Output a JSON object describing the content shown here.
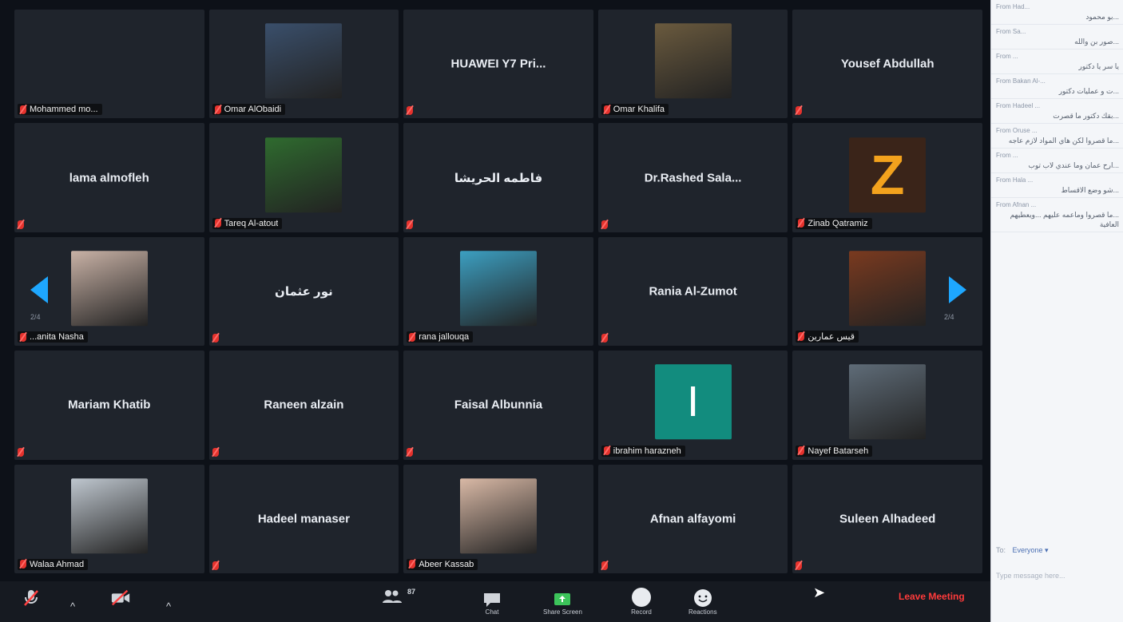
{
  "participants": [
    {
      "name": "Mohammed mo...",
      "display": "label",
      "muted": true
    },
    {
      "name": "Omar AlObaidi",
      "display": "video",
      "muted": true,
      "avatar_color": "#3a4f6b"
    },
    {
      "name": "HUAWEI Y7 Pri...",
      "display": "center",
      "muted": true
    },
    {
      "name": "Omar Khalifa",
      "display": "video",
      "muted": true,
      "avatar_color": "#6a5a3e"
    },
    {
      "name": "Yousef Abdullah",
      "display": "center",
      "muted": true
    },
    {
      "name": "lama almofleh",
      "display": "center",
      "muted": true
    },
    {
      "name": "Tareq Al-atout",
      "display": "video",
      "muted": true,
      "avatar_color": "#2f6b2f"
    },
    {
      "name": "فاطمه الحريشا",
      "display": "center",
      "muted": true
    },
    {
      "name": "Dr.Rashed  Sala...",
      "display": "center",
      "muted": true
    },
    {
      "name": "Zinab Qatramiz",
      "display": "video",
      "muted": true,
      "avatar_letter": "Z"
    },
    {
      "name": "...anita Nasha",
      "display": "video",
      "muted": true,
      "avatar_color": "#c9b2a6"
    },
    {
      "name": "نور عثمان",
      "display": "center",
      "muted": true
    },
    {
      "name": "rana jallouqa",
      "display": "video",
      "muted": true,
      "avatar_color": "#3c9fc1"
    },
    {
      "name": "Rania Al-Zumot",
      "display": "center",
      "muted": true
    },
    {
      "name": "قيس عمارين",
      "display": "video",
      "muted": true,
      "avatar_color": "#7a3a1f"
    },
    {
      "name": "Mariam Khatib",
      "display": "center",
      "muted": true
    },
    {
      "name": "Raneen alzain",
      "display": "center",
      "muted": true
    },
    {
      "name": "Faisal Albunnia",
      "display": "center",
      "muted": true
    },
    {
      "name": "ibrahim harazneh",
      "display": "video",
      "muted": true,
      "avatar_letter": "I"
    },
    {
      "name": "Nayef Batarseh",
      "display": "video",
      "muted": true,
      "avatar_color": "#5f6c78"
    },
    {
      "name": "Walaa Ahmad",
      "display": "video",
      "muted": true,
      "avatar_color": "#bfc7cf"
    },
    {
      "name": "Hadeel manaser",
      "display": "center",
      "muted": true
    },
    {
      "name": "Abeer Kassab",
      "display": "video",
      "muted": true,
      "avatar_color": "#d9b9a6"
    },
    {
      "name": "Afnan alfayomi",
      "display": "center",
      "muted": true
    },
    {
      "name": "Suleen Alhadeed",
      "display": "center",
      "muted": true
    }
  ],
  "pagination": {
    "left": "2/4",
    "right": "2/4"
  },
  "toolbar": {
    "participants_count": "87",
    "chat_label": "Chat",
    "share_label": "Share Screen",
    "record_label": "Record",
    "reactions_label": "Reactions",
    "leave_label": "Leave Meeting"
  },
  "chat": {
    "messages": [
      {
        "from": "From Had...",
        "text": "...بو محمود"
      },
      {
        "from": "From Sa...",
        "text": "...صور بن والله"
      },
      {
        "from": "From ...",
        "text": "يا سر يا دكتور"
      },
      {
        "from": "From Bakan Al-...",
        "text": "...ت و عمليات دكتور"
      },
      {
        "from": "From Hadeel ...",
        "text": "...بقك دكتور ما قصرت"
      },
      {
        "from": "From Oruse ...",
        "text": "...ما قصروا لكن هاي المواد لازم عاجه"
      },
      {
        "from": "From ...",
        "text": "...ارح عمان وما عندي لاب توب"
      },
      {
        "from": "From Hala ...",
        "text": "...شو وضع الاقساط"
      },
      {
        "from": "From Afnan ...",
        "text": "...ما قصروا وماعمه عليهم ...ويعطيهم العافية"
      }
    ],
    "to_label": "To:",
    "to_value": "Everyone ▾",
    "input_placeholder": "Type message here..."
  }
}
